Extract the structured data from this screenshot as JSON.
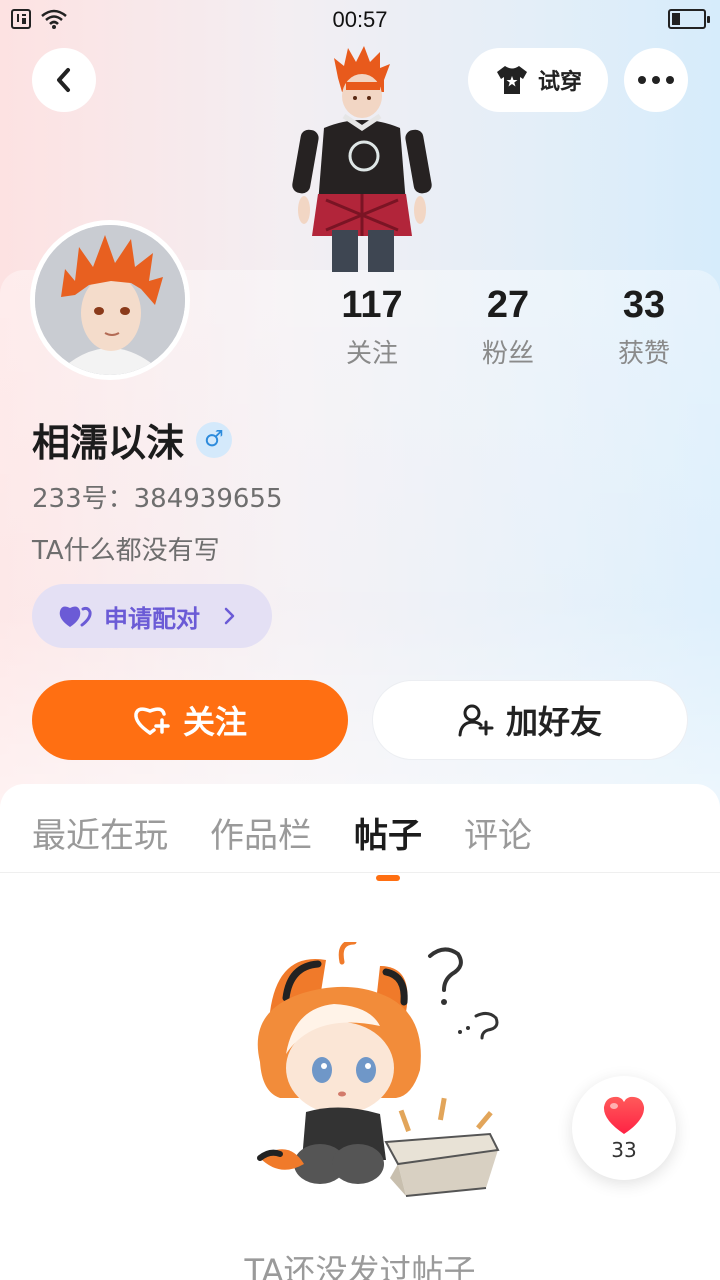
{
  "status_bar": {
    "time": "00:57"
  },
  "header": {
    "try_on_label": "试穿"
  },
  "stats": [
    {
      "value": "117",
      "label": "关注"
    },
    {
      "value": "27",
      "label": "粉丝"
    },
    {
      "value": "33",
      "label": "获赞"
    }
  ],
  "profile": {
    "name": "相濡以沫",
    "gender_symbol": "♂",
    "uid": "233号：384939655",
    "bio": "TA什么都没有写",
    "pair_label": "申请配对"
  },
  "actions": {
    "follow_label": "关注",
    "add_friend_label": "加好友"
  },
  "tabs": [
    {
      "label": "最近在玩"
    },
    {
      "label": "作品栏"
    },
    {
      "label": "帖子",
      "active": true
    },
    {
      "label": "评论"
    }
  ],
  "empty_state": {
    "text": "TA还没发过帖子"
  },
  "like_float": {
    "count": "33"
  },
  "colors": {
    "accent": "#ff6f12",
    "pair": "#6b5bd6",
    "gender": "#2d8bdc"
  }
}
